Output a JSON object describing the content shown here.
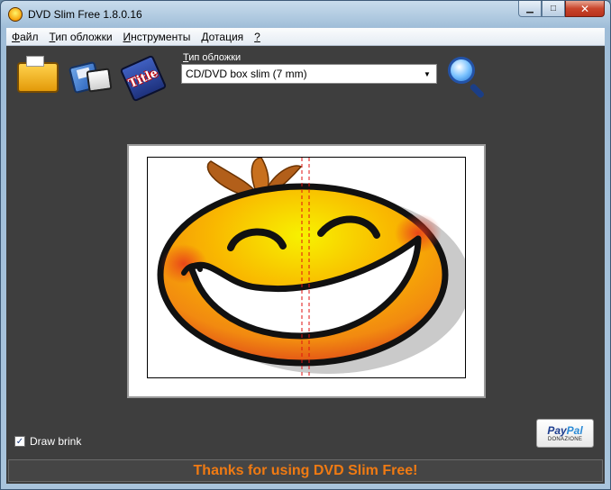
{
  "window": {
    "title": "DVD Slim Free 1.8.0.16",
    "minimize_glyph": "▁",
    "maximize_glyph": "□",
    "close_glyph": "✕"
  },
  "menu": [
    {
      "prefix": "",
      "underline": "Ф",
      "rest": "айл"
    },
    {
      "prefix": "",
      "underline": "Т",
      "rest": "ип обложки"
    },
    {
      "prefix": "",
      "underline": "И",
      "rest": "нструменты"
    },
    {
      "prefix": "",
      "underline": "Д",
      "rest": "отация"
    },
    {
      "prefix": "",
      "underline": "?",
      "rest": ""
    }
  ],
  "toolbar": {
    "title_icon_text": "Title",
    "cover_type_label_underline": "Т",
    "cover_type_label_rest": "ип обложки",
    "cover_type_value": "CD/DVD box slim (7 mm)",
    "dropdown_arrow": "▼"
  },
  "options": {
    "draw_brink_label": "Draw brink",
    "draw_brink_checked": "✓"
  },
  "paypal": {
    "brand_part1": "Pay",
    "brand_part2": "Pal",
    "sub": "DONAZIONE"
  },
  "status": {
    "text": "Thanks for using DVD Slim Free!"
  },
  "colors": {
    "status_text": "#f07a12",
    "client_bg": "#3e3e3e",
    "spine_guides": "#e11111"
  },
  "preview": {
    "image": "smiley-face-cover"
  }
}
